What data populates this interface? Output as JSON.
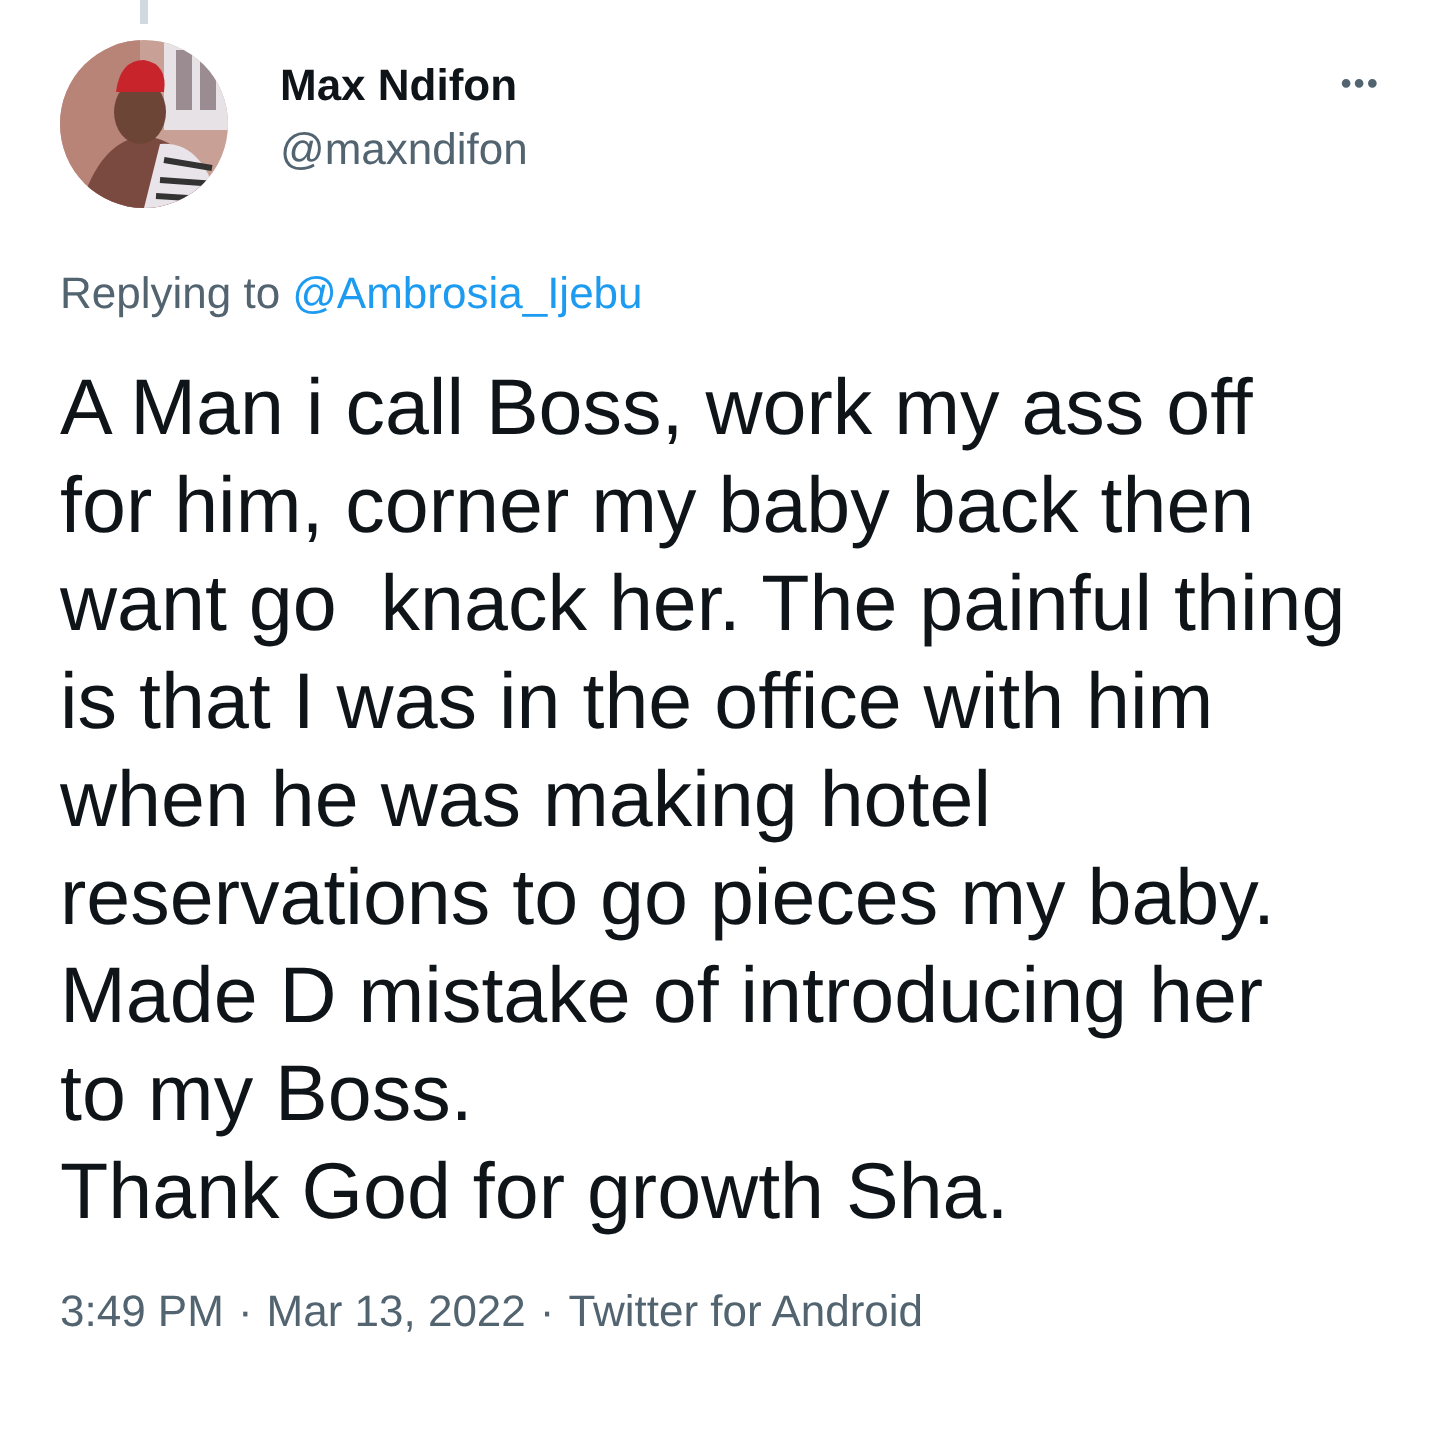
{
  "author": {
    "name": "Max Ndifon",
    "handle": "@maxndifon"
  },
  "more_menu": "•••",
  "reply_context": {
    "prefix": "Replying to",
    "mention": "@Ambrosia_Ijebu"
  },
  "text": "A Man i call Boss, work my ass off\nfor him, corner my baby back then\nwant go  knack her. The painful thing\nis that I was in the office with him\nwhen he was making hotel\nreservations to go pieces my baby.\nMade D mistake of introducing her\nto my Boss.\nThank God for growth Sha.",
  "meta": {
    "time": "3:49 PM",
    "date": "Mar 13, 2022",
    "source": "Twitter for Android",
    "separators": [
      "·",
      "·"
    ]
  }
}
